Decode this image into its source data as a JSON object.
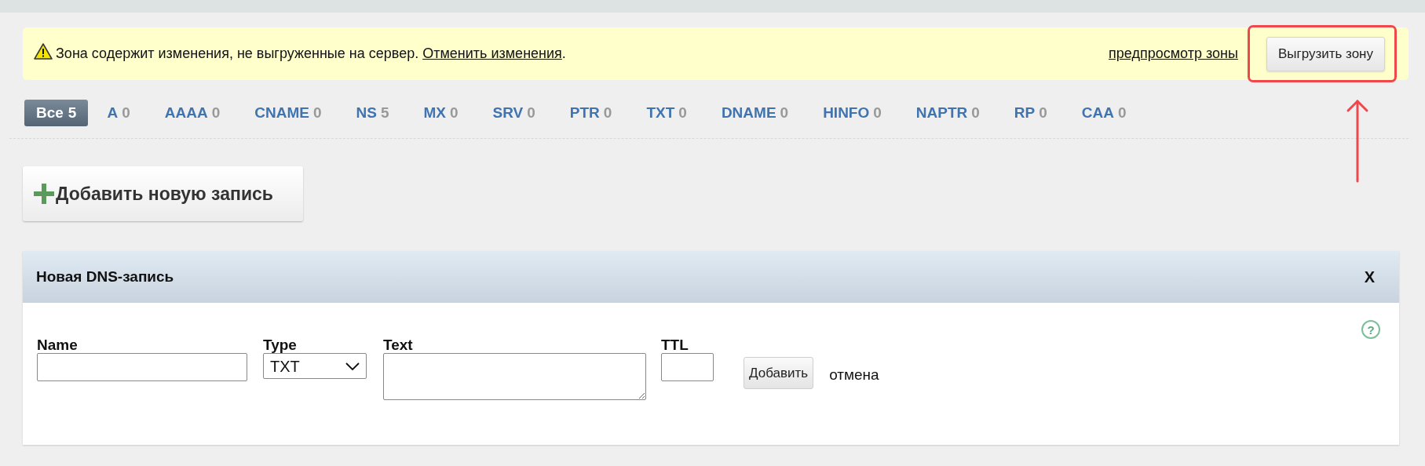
{
  "notice": {
    "text": "Зона содержит изменения, не выгруженные на сервер.",
    "undo_link": "Отменить изменения",
    "trailing": ".",
    "preview_link": "предпросмотр зоны",
    "upload_button": "Выгрузить зону"
  },
  "filter_tabs": [
    {
      "label": "Все",
      "count": "5",
      "selected": true
    },
    {
      "label": "A",
      "count": "0",
      "selected": false
    },
    {
      "label": "AAAA",
      "count": "0",
      "selected": false
    },
    {
      "label": "CNAME",
      "count": "0",
      "selected": false
    },
    {
      "label": "NS",
      "count": "5",
      "selected": false
    },
    {
      "label": "MX",
      "count": "0",
      "selected": false
    },
    {
      "label": "SRV",
      "count": "0",
      "selected": false
    },
    {
      "label": "PTR",
      "count": "0",
      "selected": false
    },
    {
      "label": "TXT",
      "count": "0",
      "selected": false
    },
    {
      "label": "DNAME",
      "count": "0",
      "selected": false
    },
    {
      "label": "HINFO",
      "count": "0",
      "selected": false
    },
    {
      "label": "NAPTR",
      "count": "0",
      "selected": false
    },
    {
      "label": "RP",
      "count": "0",
      "selected": false
    },
    {
      "label": "CAA",
      "count": "0",
      "selected": false
    }
  ],
  "add_button": "Добавить новую запись",
  "panel": {
    "title": "Новая DNS-запись",
    "close": "X",
    "fields": [
      {
        "kind": "input",
        "label": "Name"
      },
      {
        "kind": "select",
        "label": "Type",
        "value": "TXT"
      },
      {
        "kind": "textarea",
        "label": "Text"
      },
      {
        "kind": "ttl",
        "label": "TTL"
      }
    ],
    "submit": "Добавить",
    "cancel": "отмена",
    "help": "?"
  }
}
